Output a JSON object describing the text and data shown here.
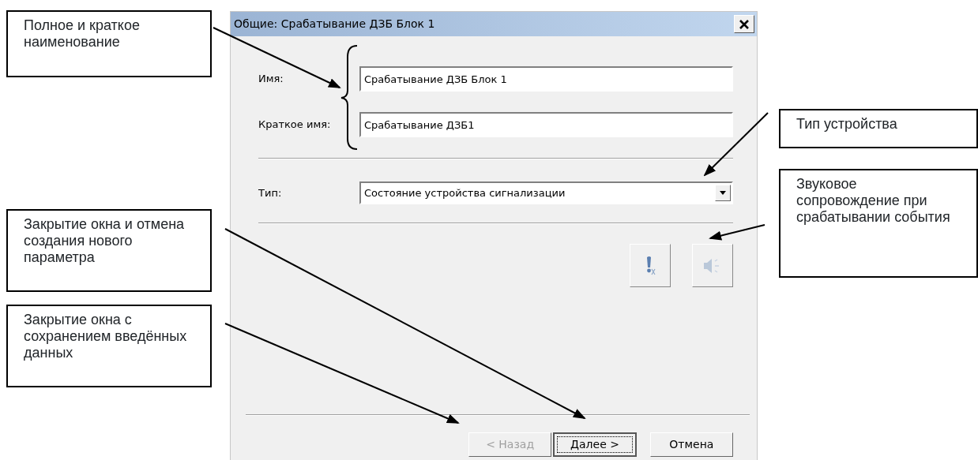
{
  "dialog": {
    "title": "Общие: Срабатывание ДЗБ Блок 1",
    "fields": [
      {
        "label": "Имя:",
        "value": "Срабатывание ДЗБ Блок 1"
      },
      {
        "label": "Краткое имя:",
        "value": "Срабатывание ДЗБ1"
      }
    ],
    "type_field": {
      "label": "Тип:",
      "value": "Состояние устройства сигнализации"
    },
    "tool_buttons": [
      {
        "kind": "alert",
        "disabled": false
      },
      {
        "kind": "sound",
        "disabled": true
      }
    ],
    "buttons": [
      {
        "label": "< Назад",
        "disabled": true,
        "default": false
      },
      {
        "label": "Далее >",
        "disabled": false,
        "default": true
      },
      {
        "label": "Отмена",
        "disabled": false,
        "default": false
      }
    ]
  },
  "callouts": [
    {
      "text": "Полное и краткое наименование"
    },
    {
      "text": "Тип устройства"
    },
    {
      "text": "Звуковое сопровождение при срабатывании события"
    },
    {
      "text": "Закрытие окна и отмена создания нового параметра"
    },
    {
      "text": "Закрытие окна с сохранением введённых данных"
    }
  ]
}
